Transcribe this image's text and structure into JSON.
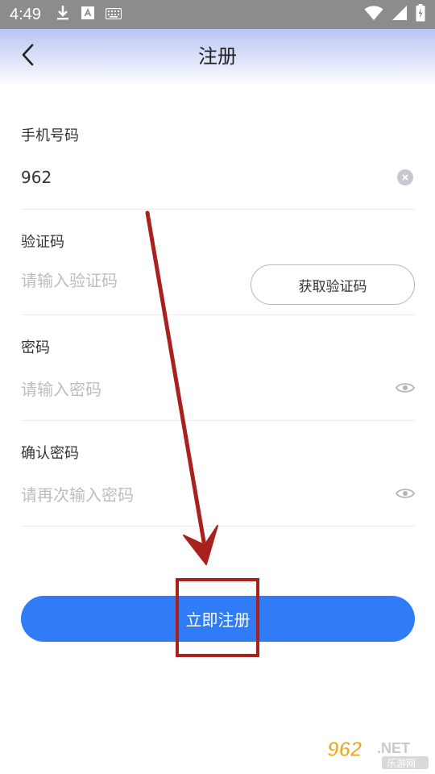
{
  "status_bar": {
    "time": "4:49",
    "left_icons": [
      "download-icon",
      "a-badge-icon",
      "keyboard-icon"
    ],
    "right_icons": [
      "wifi-icon",
      "signal-icon",
      "battery-charging-icon"
    ]
  },
  "header": {
    "title": "注册",
    "back_icon": "chevron-left-icon"
  },
  "form": {
    "phone": {
      "label": "手机号码",
      "value": "962",
      "clear_icon": "clear-circle-icon"
    },
    "code": {
      "label": "验证码",
      "placeholder": "请输入验证码",
      "button_label": "获取验证码"
    },
    "password": {
      "label": "密码",
      "placeholder": "请输入密码",
      "toggle_icon": "eye-icon"
    },
    "confirm_password": {
      "label": "确认密码",
      "placeholder": "请再次输入密码",
      "toggle_icon": "eye-icon"
    }
  },
  "register_button": {
    "label": "立即注册"
  },
  "colors": {
    "primary": "#2f7cf6",
    "annotation": "#a9211c",
    "placeholder": "#bdbdbd"
  },
  "watermark": {
    "main": "962",
    "suffix": ".NET",
    "subtitle": "乐游网"
  }
}
